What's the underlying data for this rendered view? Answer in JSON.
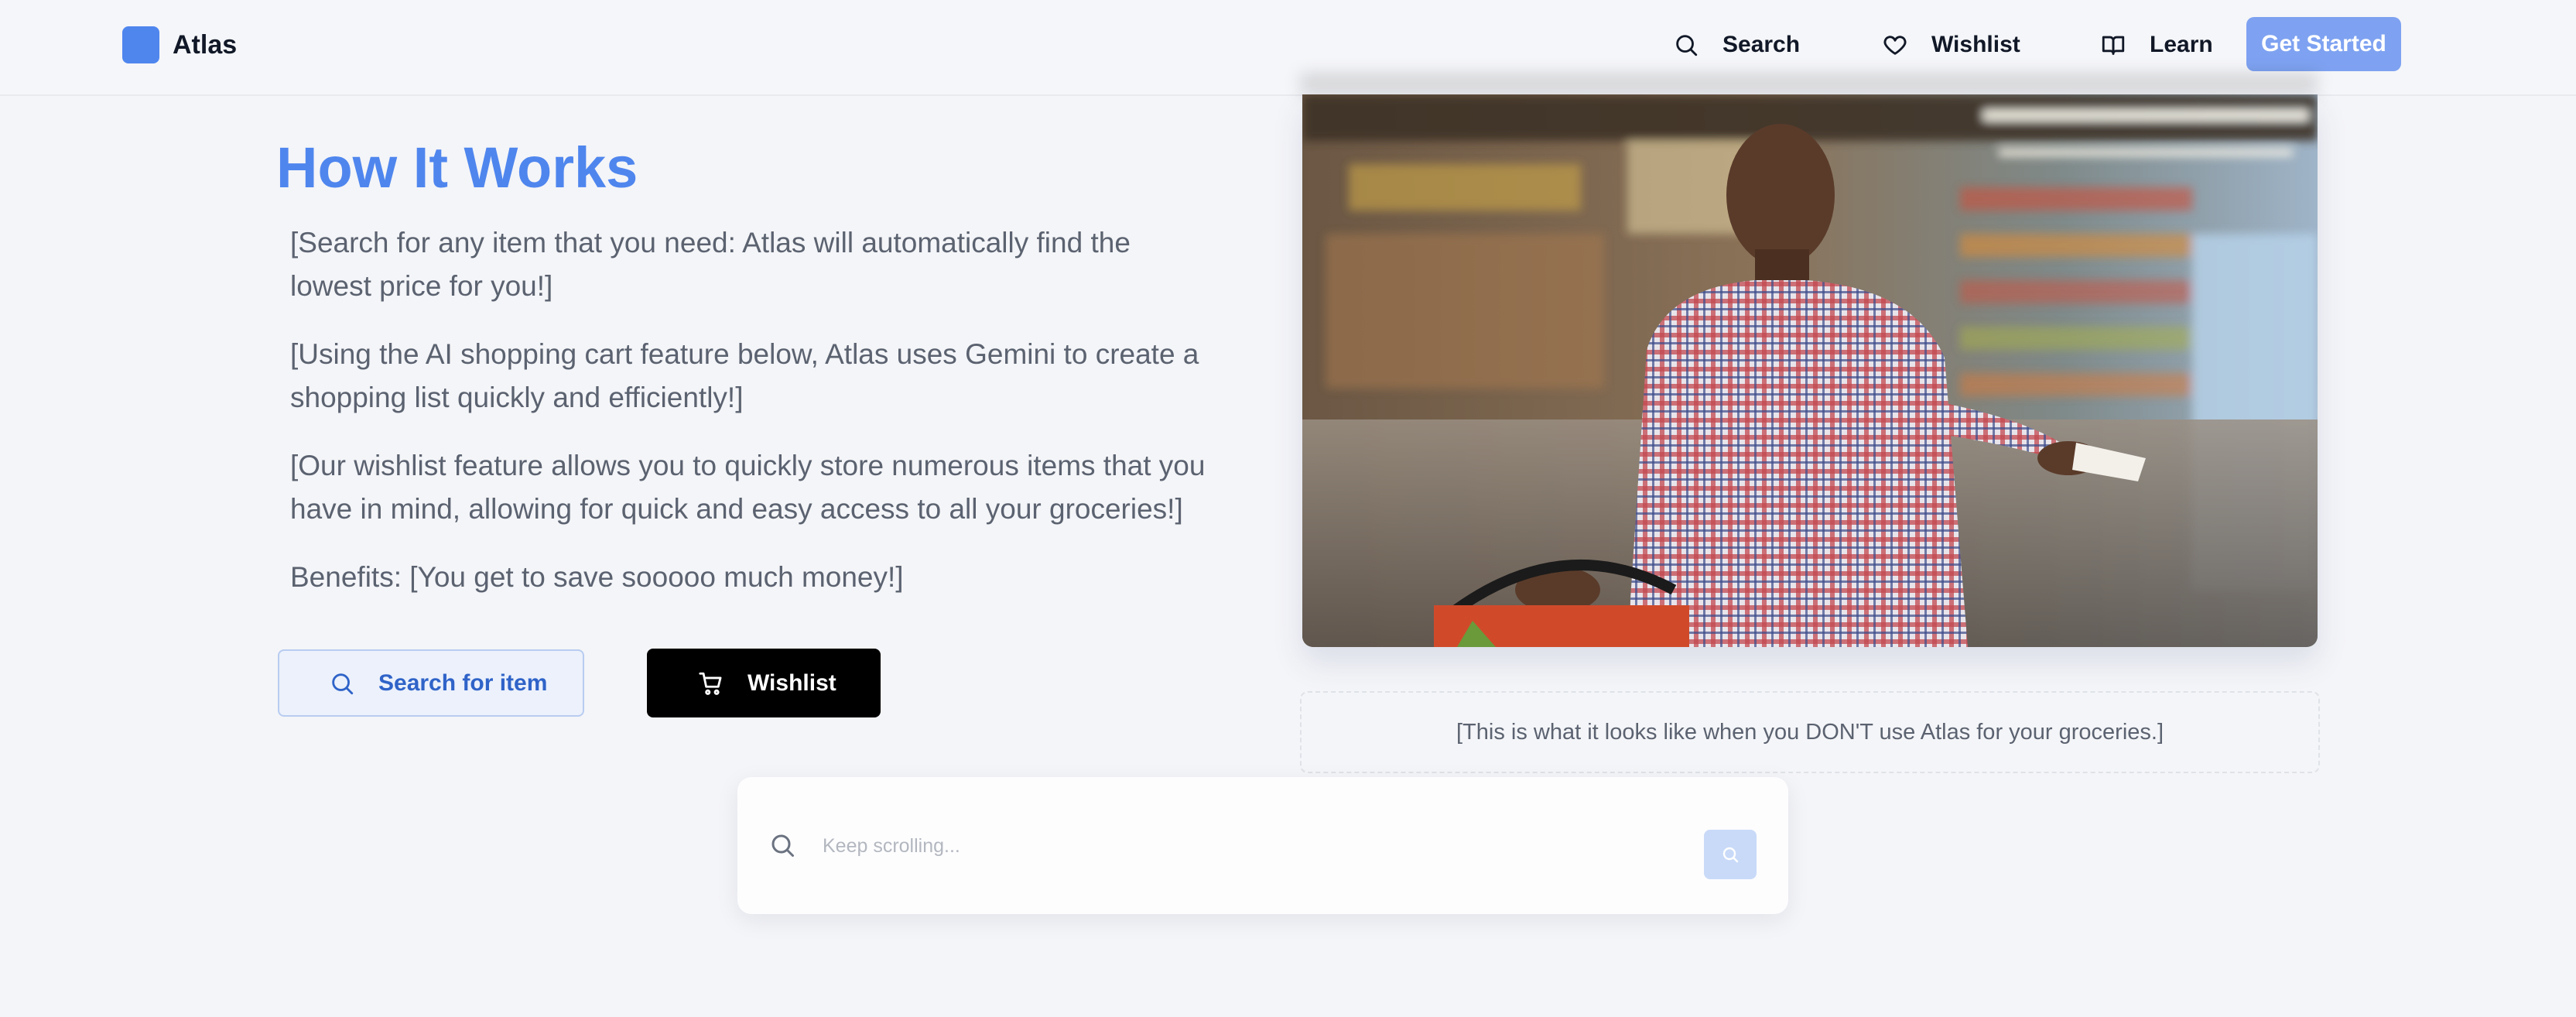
{
  "brand": {
    "name": "Atlas",
    "color": "#4f86ee"
  },
  "nav": {
    "links": [
      {
        "label": "Search",
        "icon": "search-icon"
      },
      {
        "label": "Wishlist",
        "icon": "heart-icon"
      },
      {
        "label": "Learn",
        "icon": "book-icon"
      }
    ],
    "cta_label": "Get Started"
  },
  "hero": {
    "title": "How It Works",
    "paragraphs": [
      "[Search for any item that you need: Atlas will automatically find the lowest price for you!]",
      "[Using the AI shopping cart feature below, Atlas uses Gemini to create a shopping list quickly and efficiently!]",
      "[Our wishlist feature allows you to quickly store numerous items that you have in mind, allowing for quick and easy access to all your groceries!]",
      "Benefits: [You get to save sooooo much money!]"
    ],
    "search_button": "Search for item",
    "wishlist_button": "Wishlist"
  },
  "photo": {
    "caption": "[This is what it looks like when you DON'T use Atlas for your groceries.]"
  },
  "searchbar": {
    "placeholder": "Keep scrolling..."
  }
}
